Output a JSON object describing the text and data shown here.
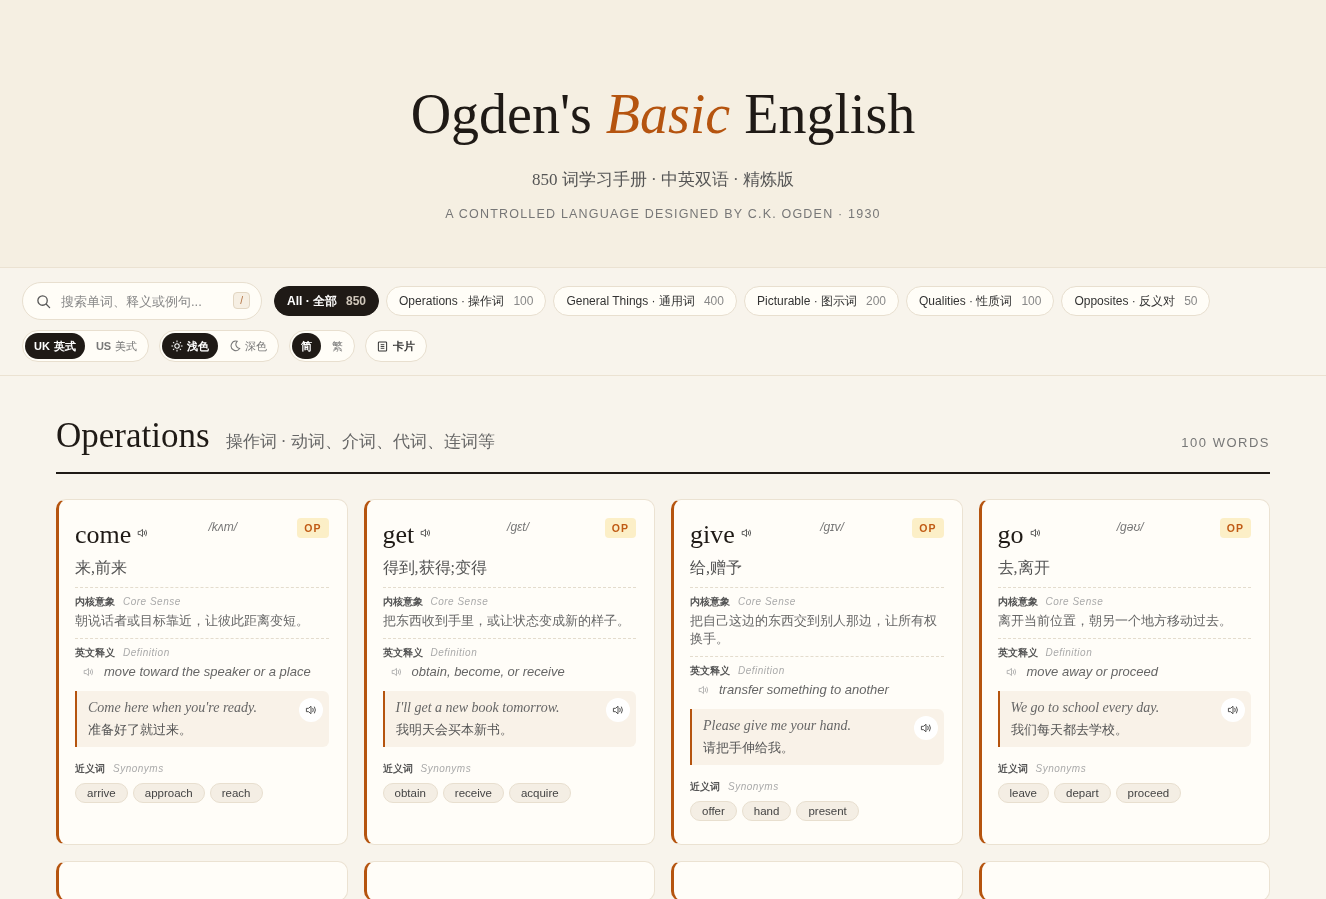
{
  "header": {
    "title": "Ogden's *Basic* English",
    "subtitle": "850 词学习手册 · 中英双语 · 精炼版",
    "tagline": "A CONTROLLED LANGUAGE DESIGNED BY C.K. OGDEN · 1930"
  },
  "search": {
    "placeholder": "搜索单词、释义或例句...",
    "shortcut": "/"
  },
  "filters": [
    {
      "label": "All · 全部",
      "count": "850",
      "selected": true
    },
    {
      "label": "Operations · 操作词",
      "count": "100",
      "selected": false
    },
    {
      "label": "General Things · 通用词",
      "count": "400",
      "selected": false
    },
    {
      "label": "Picturable · 图示词",
      "count": "200",
      "selected": false
    },
    {
      "label": "Qualities · 性质词",
      "count": "100",
      "selected": false
    },
    {
      "label": "Opposites · 反义对",
      "count": "50",
      "selected": false
    }
  ],
  "accent_toggle": [
    {
      "code": "UK",
      "label": "英式",
      "selected": true
    },
    {
      "code": "US",
      "label": "美式",
      "selected": false
    }
  ],
  "theme_toggle": [
    {
      "label": "浅色",
      "selected": true
    },
    {
      "label": "深色",
      "selected": false
    }
  ],
  "script_toggle": [
    {
      "label": "简",
      "selected": true
    },
    {
      "label": "繁",
      "selected": false
    }
  ],
  "view_button": {
    "label": "卡片"
  },
  "section": {
    "title": "Operations",
    "subtitle": "操作词 · 动词、介词、代词、连词等",
    "count": "100 WORDS"
  },
  "cards": [
    {
      "word": "come",
      "phonetic": "/kʌm/",
      "badge": "OP",
      "meaning": "来,前来",
      "core_label": "内核意象",
      "core_label_en": "Core Sense",
      "core": "朝说话者或目标靠近，让彼此距离变短。",
      "def_label": "英文释义",
      "def_label_en": "Definition",
      "definition": "move toward the speaker or a place",
      "example_en": "Come here when you're ready.",
      "example_zh": "准备好了就过来。",
      "syn_label": "近义词",
      "syn_label_en": "Synonyms",
      "synonyms": [
        "arrive",
        "approach",
        "reach"
      ]
    },
    {
      "word": "get",
      "phonetic": "/gɛt/",
      "badge": "OP",
      "meaning": "得到,获得;变得",
      "core_label": "内核意象",
      "core_label_en": "Core Sense",
      "core": "把东西收到手里，或让状态变成新的样子。",
      "def_label": "英文释义",
      "def_label_en": "Definition",
      "definition": "obtain, become, or receive",
      "example_en": "I'll get a new book tomorrow.",
      "example_zh": "我明天会买本新书。",
      "syn_label": "近义词",
      "syn_label_en": "Synonyms",
      "synonyms": [
        "obtain",
        "receive",
        "acquire"
      ]
    },
    {
      "word": "give",
      "phonetic": "/gɪv/",
      "badge": "OP",
      "meaning": "给,赠予",
      "core_label": "内核意象",
      "core_label_en": "Core Sense",
      "core": "把自己这边的东西交到别人那边，让所有权换手。",
      "def_label": "英文释义",
      "def_label_en": "Definition",
      "definition": "transfer something to another",
      "example_en": "Please give me your hand.",
      "example_zh": "请把手伸给我。",
      "syn_label": "近义词",
      "syn_label_en": "Synonyms",
      "synonyms": [
        "offer",
        "hand",
        "present"
      ]
    },
    {
      "word": "go",
      "phonetic": "/gəʊ/",
      "badge": "OP",
      "meaning": "去,离开",
      "core_label": "内核意象",
      "core_label_en": "Core Sense",
      "core": "离开当前位置，朝另一个地方移动过去。",
      "def_label": "英文释义",
      "def_label_en": "Definition",
      "definition": "move away or proceed",
      "example_en": "We go to school every day.",
      "example_zh": "我们每天都去学校。",
      "syn_label": "近义词",
      "syn_label_en": "Synonyms",
      "synonyms": [
        "leave",
        "depart",
        "proceed"
      ]
    }
  ]
}
